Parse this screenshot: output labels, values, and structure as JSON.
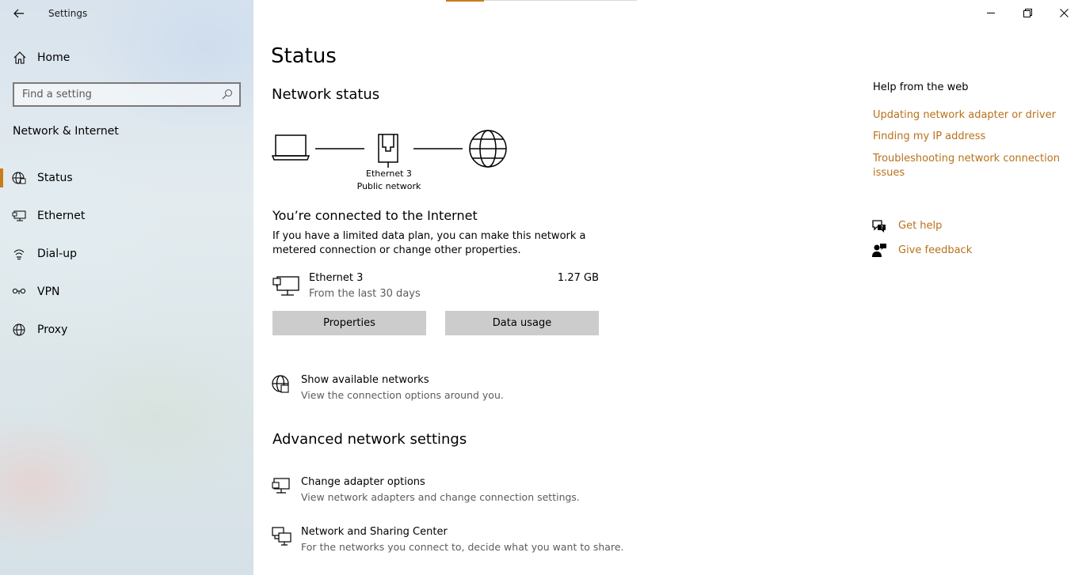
{
  "window": {
    "app_title": "Settings",
    "accent_color": "#c87c1a",
    "link_color": "#b8711a"
  },
  "sidebar": {
    "home_label": "Home",
    "search_placeholder": "Find a setting",
    "section_title": "Network & Internet",
    "items": [
      {
        "label": "Status",
        "icon": "globe-icon",
        "selected": true
      },
      {
        "label": "Ethernet",
        "icon": "ethernet-icon",
        "selected": false
      },
      {
        "label": "Dial-up",
        "icon": "dialup-icon",
        "selected": false
      },
      {
        "label": "VPN",
        "icon": "vpn-icon",
        "selected": false
      },
      {
        "label": "Proxy",
        "icon": "globe-icon",
        "selected": false
      }
    ]
  },
  "main": {
    "title": "Status",
    "network_status_title": "Network status",
    "diagram": {
      "adapter_name": "Ethernet 3",
      "network_type": "Public network"
    },
    "connected_heading": "You’re connected to the Internet",
    "metered_text": "If you have a limited data plan, you can make this network a metered connection or change other properties.",
    "connection": {
      "name": "Ethernet 3",
      "subtitle": "From the last 30 days",
      "data_used": "1.27 GB"
    },
    "buttons": {
      "properties": "Properties",
      "data_usage": "Data usage"
    },
    "show_networks": {
      "title": "Show available networks",
      "subtitle": "View the connection options around you."
    },
    "advanced_title": "Advanced network settings",
    "change_adapter": {
      "title": "Change adapter options",
      "subtitle": "View network adapters and change connection settings."
    },
    "sharing_center": {
      "title": "Network and Sharing Center",
      "subtitle": "For the networks you connect to, decide what you want to share."
    }
  },
  "help": {
    "title": "Help from the web",
    "links": [
      "Updating network adapter or driver",
      "Finding my IP address",
      "Troubleshooting network connection issues"
    ],
    "get_help": "Get help",
    "give_feedback": "Give feedback"
  }
}
